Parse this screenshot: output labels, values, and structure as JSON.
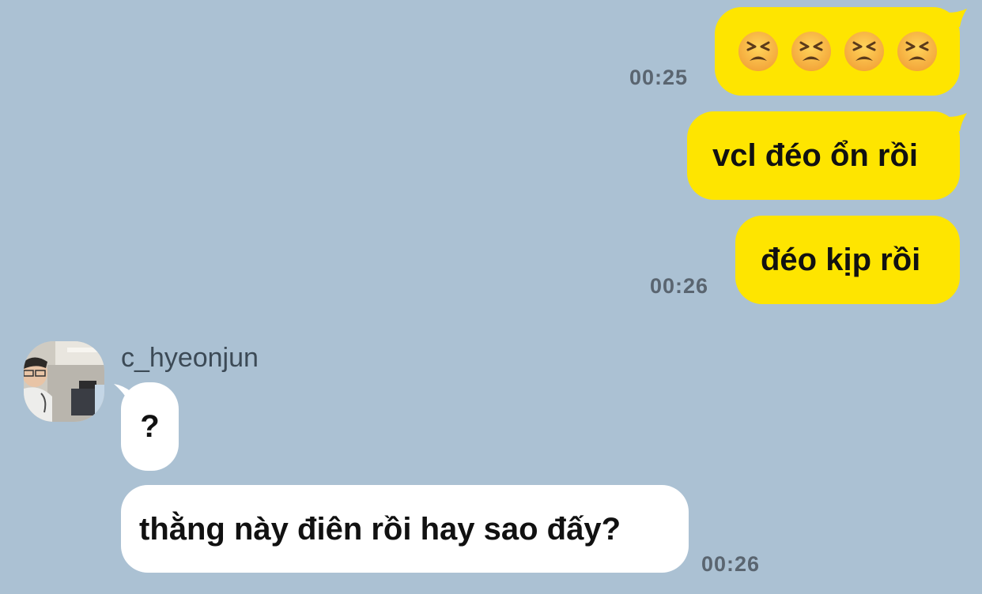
{
  "colors": {
    "background": "#abc1d3",
    "my_bubble": "#fee500",
    "their_bubble": "#ffffff",
    "timestamp": "#5a6570"
  },
  "messages": {
    "m1": {
      "emoji_count": 4,
      "emoji_name": "tired-face-emoji"
    },
    "m1_time": "00:25",
    "m2": {
      "text": "vcl đéo ổn rồi"
    },
    "m3": {
      "text": "đéo kịp rồi"
    },
    "m3_time": "00:26",
    "sender": {
      "username": "c_hyeonjun"
    },
    "m4": {
      "text": "?"
    },
    "m5": {
      "text": "thằng này điên rồi hay sao đấy?"
    },
    "m5_time": "00:26"
  }
}
